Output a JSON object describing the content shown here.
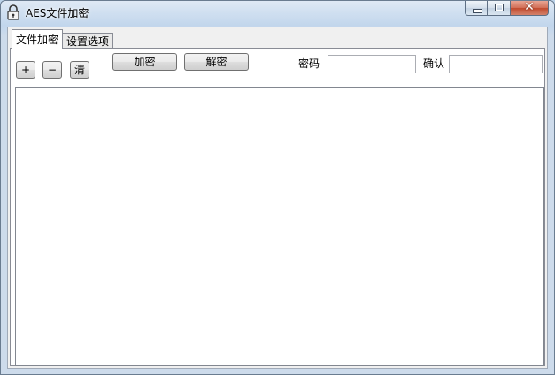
{
  "window": {
    "title": "AES文件加密",
    "icon": "lock-icon",
    "controls": {
      "minimize": "minimize-icon",
      "maximize": "maximize-icon",
      "close": "✕"
    }
  },
  "tabs": [
    {
      "label": "文件加密",
      "active": true
    },
    {
      "label": "设置选项",
      "active": false
    }
  ],
  "toolbar": {
    "add_label": "+",
    "remove_label": "−",
    "clear_label": "清",
    "encrypt_label": "加密",
    "decrypt_label": "解密",
    "password_label": "密码",
    "password_value": "",
    "confirm_label": "确认",
    "confirm_value": ""
  },
  "file_list": {
    "items": []
  },
  "colors": {
    "titlebar": "#c8dbef",
    "close_button": "#c85a3e",
    "panel": "#ffffff"
  }
}
